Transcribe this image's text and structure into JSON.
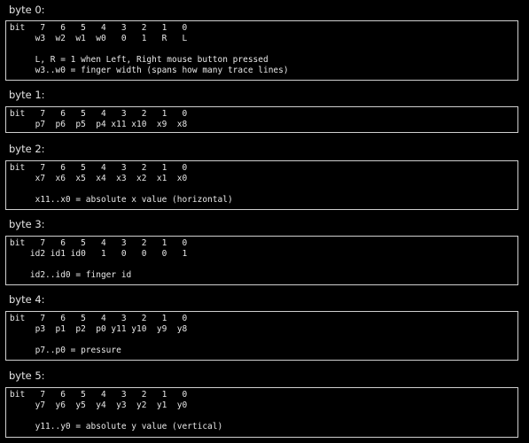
{
  "sections": [
    {
      "heading": "byte 0:",
      "bits_line": "bit   7   6   5   4   3   2   1   0",
      "names_line": "     w3  w2  w1  w0   0   1   R   L",
      "notes": [
        "     L, R = 1 when Left, Right mouse button pressed",
        "     w3..w0 = finger width (spans how many trace lines)"
      ]
    },
    {
      "heading": "byte 1:",
      "bits_line": "bit   7   6   5   4   3   2   1   0",
      "names_line": "     p7  p6  p5  p4 x11 x10  x9  x8",
      "notes": []
    },
    {
      "heading": "byte 2:",
      "bits_line": "bit   7   6   5   4   3   2   1   0",
      "names_line": "     x7  x6  x5  x4  x3  x2  x1  x0",
      "notes": [
        "     x11..x0 = absolute x value (horizontal)"
      ]
    },
    {
      "heading": "byte 3:",
      "bits_line": "bit   7   6   5   4   3   2   1   0",
      "names_line": "    id2 id1 id0   1   0   0   0   1",
      "notes": [
        "    id2..id0 = finger id"
      ]
    },
    {
      "heading": "byte 4:",
      "bits_line": "bit   7   6   5   4   3   2   1   0",
      "names_line": "     p3  p1  p2  p0 y11 y10  y9  y8",
      "notes": [
        "     p7..p0 = pressure"
      ]
    },
    {
      "heading": "byte 5:",
      "bits_line": "bit   7   6   5   4   3   2   1   0",
      "names_line": "     y7  y6  y5  y4  y3  y2  y1  y0",
      "notes": [
        "     y11..y0 = absolute y value (vertical)"
      ]
    }
  ]
}
